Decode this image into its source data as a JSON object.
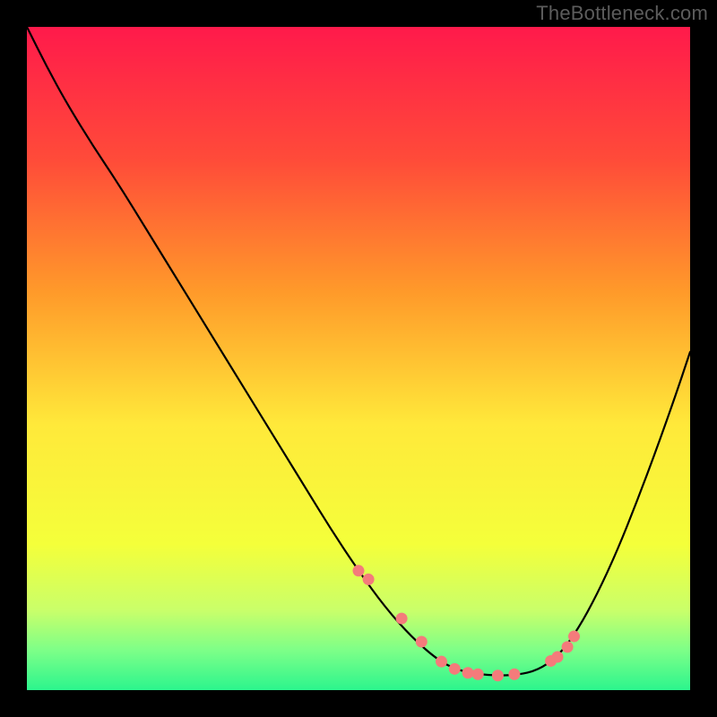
{
  "watermark": "TheBottleneck.com",
  "chart_data": {
    "type": "line",
    "title": "",
    "xlabel": "",
    "ylabel": "",
    "xlim": [
      0,
      100
    ],
    "ylim": [
      0,
      100
    ],
    "grid": false,
    "legend": false,
    "gradient_stops": [
      {
        "offset": 0.0,
        "color": "#ff1a4b"
      },
      {
        "offset": 0.2,
        "color": "#ff4b39"
      },
      {
        "offset": 0.4,
        "color": "#ff9a2a"
      },
      {
        "offset": 0.6,
        "color": "#ffe93a"
      },
      {
        "offset": 0.78,
        "color": "#f4ff3a"
      },
      {
        "offset": 0.88,
        "color": "#c9ff6a"
      },
      {
        "offset": 0.94,
        "color": "#7dff88"
      },
      {
        "offset": 1.0,
        "color": "#2cf58d"
      }
    ],
    "series": [
      {
        "name": "curve",
        "color": "#000000",
        "x": [
          0.0,
          3.0,
          6.0,
          10.0,
          14.0,
          18.0,
          22.0,
          26.0,
          30.0,
          34.0,
          38.0,
          42.0,
          46.0,
          50.0,
          54.0,
          58.0,
          62.0,
          65.0,
          68.0,
          71.0,
          74.0,
          77.0,
          80.0,
          83.0,
          86.0,
          89.0,
          92.0,
          95.0,
          98.0,
          100.0
        ],
        "y": [
          100.0,
          94.0,
          88.5,
          82.0,
          76.0,
          69.5,
          63.0,
          56.5,
          50.0,
          43.5,
          37.0,
          30.5,
          24.0,
          18.0,
          12.5,
          8.0,
          4.5,
          3.0,
          2.4,
          2.2,
          2.3,
          3.0,
          5.0,
          9.0,
          14.5,
          21.0,
          28.5,
          36.5,
          45.0,
          51.0
        ]
      }
    ],
    "markers": {
      "name": "sweet-spot-dots",
      "color": "#f47b7b",
      "radius_px": 6.5,
      "x": [
        50.0,
        51.5,
        56.5,
        59.5,
        62.5,
        64.5,
        66.5,
        68.0,
        71.0,
        73.5,
        79.0,
        80.0,
        81.5,
        82.5
      ],
      "y": [
        18.0,
        16.7,
        10.8,
        7.3,
        4.3,
        3.2,
        2.6,
        2.4,
        2.2,
        2.4,
        4.4,
        5.0,
        6.5,
        8.1
      ]
    }
  }
}
